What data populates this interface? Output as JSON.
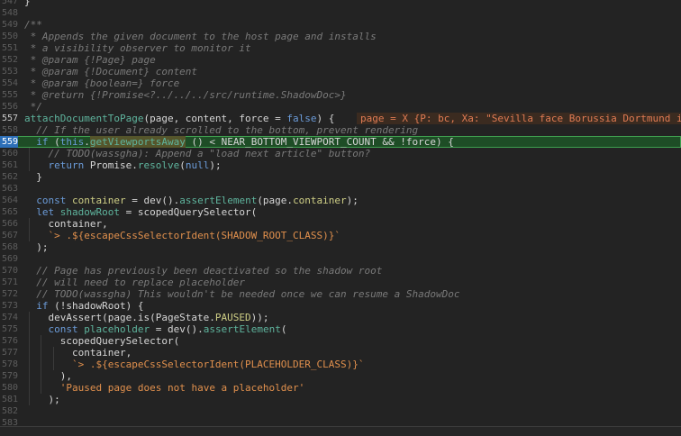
{
  "editor": {
    "lines": [
      {
        "n": "547",
        "text": "}"
      },
      {
        "n": "548",
        "text": ""
      },
      {
        "n": "549",
        "text": "/**"
      },
      {
        "n": "550",
        "text": " * Appends the given document to the host page and installs"
      },
      {
        "n": "551",
        "text": " * a visibility observer to monitor it"
      },
      {
        "n": "552",
        "text": " * @param {!Page} page"
      },
      {
        "n": "553",
        "text": " * @param {!Document} content"
      },
      {
        "n": "554",
        "text": " * @param {boolean=} force"
      },
      {
        "n": "555",
        "text": " * @return {!Promise<?../../../src/runtime.ShadowDoc>}"
      },
      {
        "n": "556",
        "text": " */"
      },
      {
        "n": "557",
        "text": "attachDocumentToPage(page, content, force = false) {"
      },
      {
        "n": "558",
        "text": "  // If the user already scrolled to the bottom, prevent rendering"
      },
      {
        "n": "559",
        "text": "  if (this.getViewportsAway () < NEAR_BOTTOM_VIEWPORT_COUNT && !force) {"
      },
      {
        "n": "560",
        "text": "    // TODO(wassgha): Append a \"load next article\" button?"
      },
      {
        "n": "561",
        "text": "    return Promise.resolve(null);"
      },
      {
        "n": "562",
        "text": "  }"
      },
      {
        "n": "563",
        "text": ""
      },
      {
        "n": "564",
        "text": "  const container = dev().assertElement(page.container);"
      },
      {
        "n": "565",
        "text": "  let shadowRoot = scopedQuerySelector("
      },
      {
        "n": "566",
        "text": "    container,"
      },
      {
        "n": "567",
        "text": "    `> .${escapeCssSelectorIdent(SHADOW_ROOT_CLASS)}`"
      },
      {
        "n": "568",
        "text": "  );"
      },
      {
        "n": "569",
        "text": ""
      },
      {
        "n": "570",
        "text": "  // Page has previously been deactivated so the shadow root"
      },
      {
        "n": "571",
        "text": "  // will need to replace placeholder"
      },
      {
        "n": "572",
        "text": "  // TODO(wassgha) This wouldn't be needed once we can resume a ShadowDoc"
      },
      {
        "n": "573",
        "text": "  if (!shadowRoot) {"
      },
      {
        "n": "574",
        "text": "    devAssert(page.is(PageState.PAUSED));"
      },
      {
        "n": "575",
        "text": "    const placeholder = dev().assertElement("
      },
      {
        "n": "576",
        "text": "      scopedQuerySelector("
      },
      {
        "n": "577",
        "text": "        container,"
      },
      {
        "n": "578",
        "text": "        `> .${escapeCssSelectorIdent(PLACEHOLDER_CLASS)}`"
      },
      {
        "n": "579",
        "text": "      ),"
      },
      {
        "n": "580",
        "text": "      'Paused page does not have a placeholder'"
      },
      {
        "n": "581",
        "text": "    );"
      },
      {
        "n": "582",
        "text": ""
      },
      {
        "n": "583",
        "text": ""
      }
    ],
    "inline_value": "page = X {P: bc, Xa: \"Sevilla face Borussia Dortmund in",
    "colors": {
      "background": "#232323",
      "active_line": "#1e4d26",
      "comment": "#7a7a7a",
      "keyword": "#6b9bd8",
      "function": "#5fb59e",
      "string": "#e1904d",
      "inline_value": "#e07b53"
    }
  }
}
